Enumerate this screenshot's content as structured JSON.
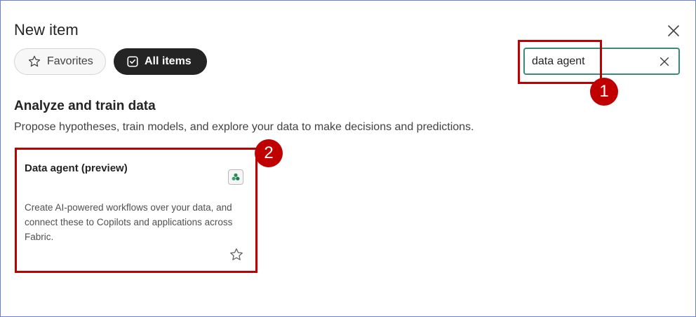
{
  "dialog": {
    "title": "New item",
    "close_icon": "close-icon"
  },
  "filters": {
    "favorites_label": "Favorites",
    "favorites_icon": "star-icon",
    "all_items_label": "All items",
    "all_items_icon": "checkbox-icon",
    "active": "All items"
  },
  "search": {
    "value": "data agent",
    "clear_icon": "close-icon"
  },
  "annotations": {
    "badge_1": "1",
    "badge_2": "2",
    "color": "#c00000"
  },
  "section": {
    "title": "Analyze and train data",
    "description": "Propose hypotheses, train models, and explore your data to make decisions and predictions."
  },
  "card": {
    "title": "Data agent (preview)",
    "icon": "data-agent-icon",
    "description": "Create AI-powered workflows over your data, and connect these to Copilots and applications across Fabric.",
    "favorite_icon": "star-outline-icon"
  },
  "colors": {
    "accent": "#3a8a7a",
    "dark_pill": "#242424",
    "frame_border": "#6b7fd6"
  }
}
